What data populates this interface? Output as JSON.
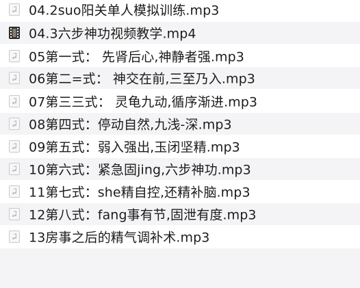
{
  "files": [
    {
      "name": "04.2suo阳关单人模拟训练.mp3",
      "icon": "audio-file-icon"
    },
    {
      "name": "04.3六步神功视频教学.mp4",
      "icon": "video-file-icon"
    },
    {
      "name": "05第一式：   先肾后心,神静者强.mp3",
      "icon": "audio-file-icon"
    },
    {
      "name": "06第二=式：   神交在前,三至乃入.mp3",
      "icon": "audio-file-icon"
    },
    {
      "name": "07第三三式：  灵龟九动,循序渐进.mp3",
      "icon": "audio-file-icon"
    },
    {
      "name": "08第四式：停动自然,九浅-深.mp3",
      "icon": "audio-file-icon"
    },
    {
      "name": "09第五式：弱入强出,玉闭坚精.mp3",
      "icon": "audio-file-icon"
    },
    {
      "name": "10第六式：紧急固jing,六步神功.mp3",
      "icon": "audio-file-icon"
    },
    {
      "name": "11第七式：she精自控,还精补脑.mp3",
      "icon": "audio-file-icon"
    },
    {
      "name": "12第八式：fang事有节,固泄有度.mp3",
      "icon": "audio-file-icon"
    },
    {
      "name": "13房事之后的精气调补术.mp3",
      "icon": "audio-file-icon"
    }
  ]
}
